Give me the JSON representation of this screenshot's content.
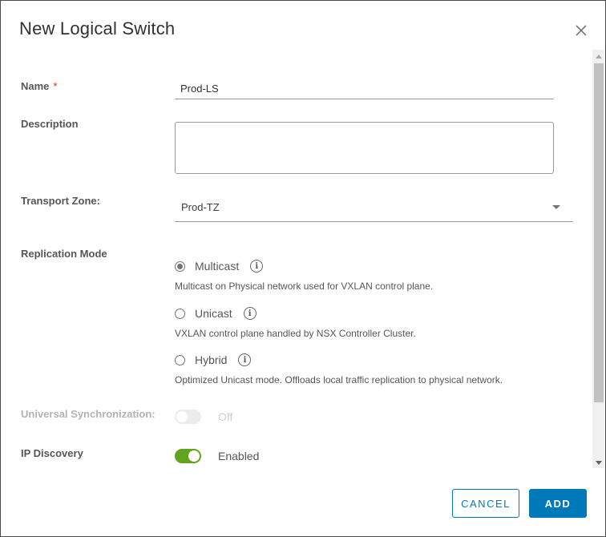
{
  "dialog": {
    "title": "New Logical Switch"
  },
  "fields": {
    "name": {
      "label": "Name",
      "required_mark": "*",
      "value": "Prod-LS"
    },
    "description": {
      "label": "Description",
      "value": ""
    },
    "transport_zone": {
      "label": "Transport Zone:",
      "value": "Prod-TZ"
    },
    "replication_mode": {
      "label": "Replication Mode",
      "selected": "Multicast",
      "options": [
        {
          "label": "Multicast",
          "description": "Multicast on Physical network used for VXLAN control plane.",
          "checked": true
        },
        {
          "label": "Unicast",
          "description": "VXLAN control plane handled by NSX Controller Cluster.",
          "checked": false
        },
        {
          "label": "Hybrid",
          "description": "Optimized Unicast mode. Offloads local traffic replication to physical network.",
          "checked": false
        }
      ]
    },
    "universal_sync": {
      "label": "Universal Synchronization:",
      "state": "Off",
      "enabled": false,
      "disabled": true
    },
    "ip_discovery": {
      "label": "IP Discovery",
      "state": "Enabled",
      "enabled": true
    }
  },
  "info_icon_glyph": "i",
  "footer": {
    "cancel_label": "CANCEL",
    "add_label": "ADD"
  },
  "colors": {
    "primary": "#0079b8",
    "toggle_on": "#62a420",
    "required": "#e62700"
  }
}
